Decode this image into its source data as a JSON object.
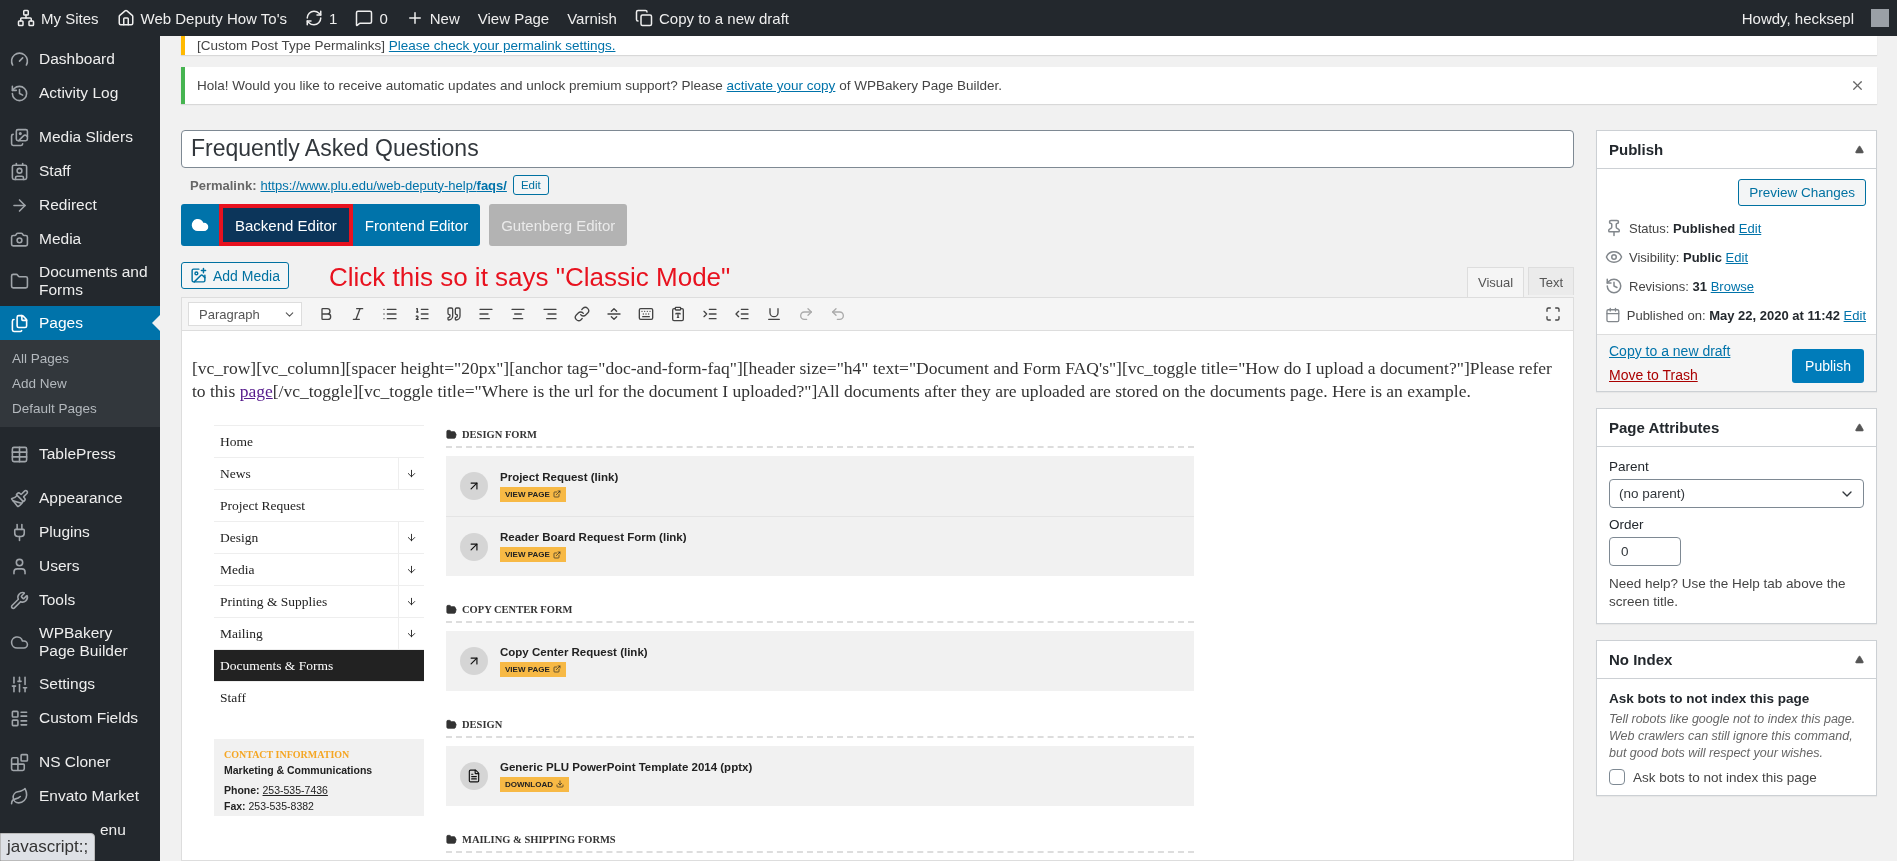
{
  "admin_bar": {
    "items": [
      {
        "label": "My Sites"
      },
      {
        "label": "Web Deputy How To's"
      },
      {
        "label": "1"
      },
      {
        "label": "0"
      },
      {
        "label": "New"
      },
      {
        "label": "View Page"
      },
      {
        "label": "Varnish"
      },
      {
        "label": "Copy to a new draft"
      }
    ],
    "greeting": "Howdy, hecksepl"
  },
  "sidebar": {
    "groups": [
      [
        {
          "label": "Dashboard",
          "selected": false
        },
        {
          "label": "Activity Log",
          "selected": false
        }
      ],
      [
        {
          "label": "Media Sliders",
          "selected": false
        },
        {
          "label": "Staff",
          "selected": false
        },
        {
          "label": "Redirect",
          "selected": false
        },
        {
          "label": "Media",
          "selected": false
        },
        {
          "label": "Documents and Forms",
          "selected": false
        },
        {
          "label": "Pages",
          "selected": true,
          "children": [
            {
              "label": "All Pages"
            },
            {
              "label": "Add New"
            },
            {
              "label": "Default Pages"
            }
          ]
        }
      ],
      [
        {
          "label": "TablePress",
          "selected": false
        }
      ],
      [
        {
          "label": "Appearance",
          "selected": false
        },
        {
          "label": "Plugins",
          "selected": false
        },
        {
          "label": "Users",
          "selected": false
        },
        {
          "label": "Tools",
          "selected": false
        },
        {
          "label": "WPBakery Page Builder",
          "selected": false
        },
        {
          "label": "Settings",
          "selected": false
        },
        {
          "label": "Custom Fields",
          "selected": false
        }
      ],
      [
        {
          "label": "NS Cloner",
          "selected": false
        },
        {
          "label": "Envato Market",
          "selected": false
        },
        {
          "label": "enu",
          "selected": false
        }
      ]
    ],
    "status_tooltip": "javascript:;"
  },
  "notices": [
    {
      "kind": "warning",
      "before": "[Custom Post Type Permalinks]",
      "link": "Please check your permalink settings.",
      "dismissible": false
    },
    {
      "kind": "success",
      "before": "Hola! Would you like to receive automatic updates and unlock premium support? Please",
      "link": "activate your copy",
      "after": "of WPBakery Page Builder.",
      "dismissible": true
    }
  ],
  "editor": {
    "title": "Frequently Asked Questions",
    "permalink_label": "Permalink:",
    "permalink_url": "https://www.plu.edu/web-deputy-help/**faqs/**",
    "permalink_edit": "Edit",
    "modes": [
      {
        "label": "Backend Editor",
        "selected": true,
        "disabled": false,
        "highlighted": true
      },
      {
        "label": "Frontend Editor",
        "selected": false,
        "disabled": false,
        "highlighted": false
      },
      {
        "label": "Gutenberg Editor",
        "selected": false,
        "disabled": true,
        "highlighted": false
      }
    ],
    "annotation": "Click this so it says \"Classic Mode\"",
    "add_media": "Add Media",
    "view_tabs": [
      {
        "label": "Visual",
        "selected": true
      },
      {
        "label": "Text",
        "selected": false
      }
    ],
    "format": "Paragraph",
    "content": {
      "before": "[vc_row][vc_column][spacer height=\"20px\"][anchor tag=\"doc-and-form-faq\"][header size=\"h4\" text=\"Document and Form FAQ's\"][vc_toggle title=\"How do I upload a document?\"]Please refer to this",
      "link": "page",
      "after": "[/vc_toggle][vc_toggle title=\"Where is the url for the document I uploaded?\"]All documents after they are uploaded are stored on the documents page. Here is an example."
    },
    "example": {
      "nav": [
        {
          "label": "Home",
          "has_submenu": false,
          "selected": false
        },
        {
          "label": "News",
          "has_submenu": true,
          "selected": false
        },
        {
          "label": "Project Request",
          "has_submenu": false,
          "selected": false
        },
        {
          "label": "Design",
          "has_submenu": true,
          "selected": false
        },
        {
          "label": "Media",
          "has_submenu": true,
          "selected": false
        },
        {
          "label": "Printing & Supplies",
          "has_submenu": true,
          "selected": false
        },
        {
          "label": "Mailing",
          "has_submenu": true,
          "selected": false
        },
        {
          "label": "Documents & Forms",
          "has_submenu": false,
          "selected": true
        },
        {
          "label": "Staff",
          "has_submenu": false,
          "selected": false
        }
      ],
      "contact": {
        "title": "CONTACT INFORMATION",
        "org": "Marketing & Communications",
        "lines": [
          {
            "label": "Phone:",
            "value": "253-535-7436",
            "link": true
          },
          {
            "label": "Fax:",
            "value": "253-535-8382",
            "link": false
          }
        ]
      },
      "sections": [
        {
          "title": "DESIGN FORM",
          "items": [
            {
              "title": "Project Request (link)",
              "kind": "link",
              "button": "VIEW PAGE"
            },
            {
              "title": "Reader Board Request Form (link)",
              "kind": "link",
              "button": "VIEW PAGE"
            }
          ]
        },
        {
          "title": "COPY CENTER FORM",
          "items": [
            {
              "title": "Copy Center Request (link)",
              "kind": "link",
              "button": "VIEW PAGE"
            }
          ]
        },
        {
          "title": "DESIGN",
          "items": [
            {
              "title": "Generic PLU PowerPoint Template 2014 (pptx)",
              "kind": "file",
              "button": "DOWNLOAD"
            }
          ]
        },
        {
          "title": "MAILING & SHIPPING FORMS"
        }
      ]
    }
  },
  "publish": {
    "title": "Publish",
    "preview": "Preview Changes",
    "rows": [
      {
        "label": "Status:",
        "value": "Published",
        "link": "Edit"
      },
      {
        "label": "Visibility:",
        "value": "Public",
        "link": "Edit"
      },
      {
        "label": "Revisions:",
        "value": "31",
        "link": "Browse"
      },
      {
        "label": "Published on:",
        "value": "May 22, 2020 at 11:42",
        "link": "Edit"
      }
    ],
    "copy_link": "Copy to a new draft",
    "trash_link": "Move to Trash",
    "button": "Publish"
  },
  "page_attributes": {
    "title": "Page Attributes",
    "parent_label": "Parent",
    "parent_value": "(no parent)",
    "order_label": "Order",
    "order_value": "0",
    "help": "Need help? Use the Help tab above the screen title."
  },
  "no_index": {
    "title": "No Index",
    "heading": "Ask bots to not index this page",
    "description": "Tell robots like google not to index this page. Web crawlers can still ignore this command, but good bots will respect your wishes.",
    "checkbox_label": "Ask bots to not index this page",
    "checked": false
  }
}
